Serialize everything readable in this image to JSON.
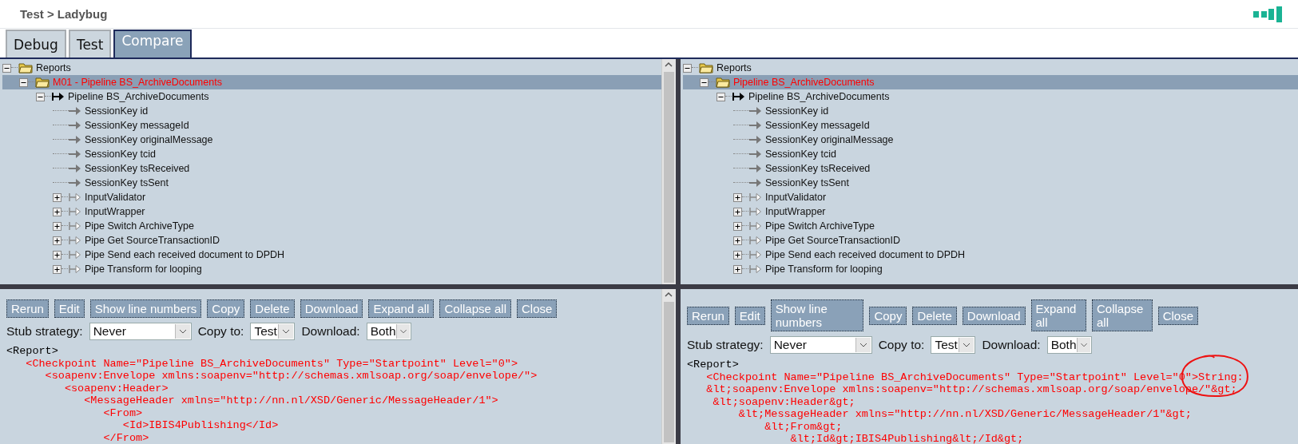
{
  "header": {
    "title": "Test > Ladybug"
  },
  "tabs": [
    {
      "label": "Debug",
      "selected": false
    },
    {
      "label": "Test",
      "selected": false
    },
    {
      "label": "Compare",
      "selected": true
    }
  ],
  "panes": [
    {
      "scrollbar": true,
      "tree": {
        "label": "Reports",
        "kind": "folder",
        "expanded": true,
        "selected": false,
        "children": [
          {
            "label": "M01 - Pipeline BS_ArchiveDocuments",
            "kind": "report",
            "expanded": true,
            "selected": true,
            "children": [
              {
                "label": "Pipeline BS_ArchiveDocuments",
                "kind": "start",
                "expanded": true,
                "selected": false,
                "children": [
                  {
                    "label": "SessionKey id",
                    "kind": "point",
                    "selected": false
                  },
                  {
                    "label": "SessionKey messageId",
                    "kind": "point",
                    "selected": false
                  },
                  {
                    "label": "SessionKey originalMessage",
                    "kind": "point",
                    "selected": false
                  },
                  {
                    "label": "SessionKey tcid",
                    "kind": "point",
                    "selected": false
                  },
                  {
                    "label": "SessionKey tsReceived",
                    "kind": "point",
                    "selected": false
                  },
                  {
                    "label": "SessionKey tsSent",
                    "kind": "point",
                    "selected": false
                  },
                  {
                    "label": "InputValidator",
                    "kind": "pipe",
                    "expanded": false,
                    "selected": false
                  },
                  {
                    "label": "InputWrapper",
                    "kind": "pipe",
                    "expanded": false,
                    "selected": false
                  },
                  {
                    "label": "Pipe Switch ArchiveType",
                    "kind": "pipe",
                    "expanded": false,
                    "selected": false
                  },
                  {
                    "label": "Pipe Get SourceTransactionID",
                    "kind": "pipe",
                    "expanded": false,
                    "selected": false
                  },
                  {
                    "label": "Pipe Send each received document to DPDH",
                    "kind": "pipe",
                    "expanded": false,
                    "selected": false
                  },
                  {
                    "label": "Pipe Transform for looping",
                    "kind": "pipe",
                    "expanded": false,
                    "selected": false
                  }
                ]
              }
            ]
          }
        ]
      },
      "buttons": [
        "Rerun",
        "Edit",
        "Show line numbers",
        "Copy",
        "Delete",
        "Download",
        "Expand all",
        "Collapse all",
        "Close"
      ],
      "fields": [
        {
          "label": "Stub strategy:",
          "value": "Never"
        },
        {
          "label": "Copy to:",
          "value": "Test"
        },
        {
          "label": "Download:",
          "value": "Both"
        }
      ],
      "code": [
        {
          "text": "<Report>",
          "color": "#000000"
        },
        {
          "text": "   <Checkpoint Name=\"Pipeline BS_ArchiveDocuments\" Type=\"Startpoint\" Level=\"0\">",
          "color": "#ff0000"
        },
        {
          "text": "      <soapenv:Envelope xmlns:soapenv=\"http://schemas.xmlsoap.org/soap/envelope/\">",
          "color": "#ff0000"
        },
        {
          "text": "         <soapenv:Header>",
          "color": "#ff0000"
        },
        {
          "text": "            <MessageHeader xmlns=\"http://nn.nl/XSD/Generic/MessageHeader/1\">",
          "color": "#ff0000"
        },
        {
          "text": "               <From>",
          "color": "#ff0000"
        },
        {
          "text": "                  <Id>IBIS4Publishing</Id>",
          "color": "#ff0000"
        },
        {
          "text": "               </From>",
          "color": "#ff0000"
        }
      ],
      "annotation": false
    },
    {
      "scrollbar": false,
      "tree": {
        "label": "Reports",
        "kind": "folder",
        "expanded": true,
        "selected": false,
        "children": [
          {
            "label": "Pipeline BS_ArchiveDocuments",
            "kind": "report",
            "expanded": true,
            "selected": true,
            "children": [
              {
                "label": "Pipeline BS_ArchiveDocuments",
                "kind": "start",
                "expanded": true,
                "selected": false,
                "children": [
                  {
                    "label": "SessionKey id",
                    "kind": "point",
                    "selected": false
                  },
                  {
                    "label": "SessionKey messageId",
                    "kind": "point",
                    "selected": false
                  },
                  {
                    "label": "SessionKey originalMessage",
                    "kind": "point",
                    "selected": false
                  },
                  {
                    "label": "SessionKey tcid",
                    "kind": "point",
                    "selected": false
                  },
                  {
                    "label": "SessionKey tsReceived",
                    "kind": "point",
                    "selected": false
                  },
                  {
                    "label": "SessionKey tsSent",
                    "kind": "point",
                    "selected": false
                  },
                  {
                    "label": "InputValidator",
                    "kind": "pipe",
                    "expanded": false,
                    "selected": false
                  },
                  {
                    "label": "InputWrapper",
                    "kind": "pipe",
                    "expanded": false,
                    "selected": false
                  },
                  {
                    "label": "Pipe Switch ArchiveType",
                    "kind": "pipe",
                    "expanded": false,
                    "selected": false
                  },
                  {
                    "label": "Pipe Get SourceTransactionID",
                    "kind": "pipe",
                    "expanded": false,
                    "selected": false
                  },
                  {
                    "label": "Pipe Send each received document to DPDH",
                    "kind": "pipe",
                    "expanded": false,
                    "selected": false
                  },
                  {
                    "label": "Pipe Transform for looping",
                    "kind": "pipe",
                    "expanded": false,
                    "selected": false
                  }
                ]
              }
            ]
          }
        ]
      },
      "buttons": [
        "Rerun",
        "Edit",
        "Show line numbers",
        "Copy",
        "Delete",
        "Download",
        "Expand all",
        "Collapse all",
        "Close"
      ],
      "fields": [
        {
          "label": "Stub strategy:",
          "value": "Never"
        },
        {
          "label": "Copy to:",
          "value": "Test"
        },
        {
          "label": "Download:",
          "value": "Both"
        }
      ],
      "code": [
        {
          "text": "<Report>",
          "color": "#000000"
        },
        {
          "text": "   <Checkpoint Name=\"Pipeline BS_ArchiveDocuments\" Type=\"Startpoint\" Level=\"0\">String:",
          "color": "#ff0000"
        },
        {
          "text": "   &lt;soapenv:Envelope xmlns:soapenv=\"http://schemas.xmlsoap.org/soap/envelope/\"&gt;",
          "color": "#ff0000"
        },
        {
          "text": "    &lt;soapenv:Header&gt;",
          "color": "#ff0000"
        },
        {
          "text": "        &lt;MessageHeader xmlns=\"http://nn.nl/XSD/Generic/MessageHeader/1\"&gt;",
          "color": "#ff0000"
        },
        {
          "text": "            &lt;From&gt;",
          "color": "#ff0000"
        },
        {
          "text": "                &lt;Id&gt;IBIS4Publishing&lt;/Id&gt;",
          "color": "#ff0000"
        }
      ],
      "annotation": true
    }
  ]
}
